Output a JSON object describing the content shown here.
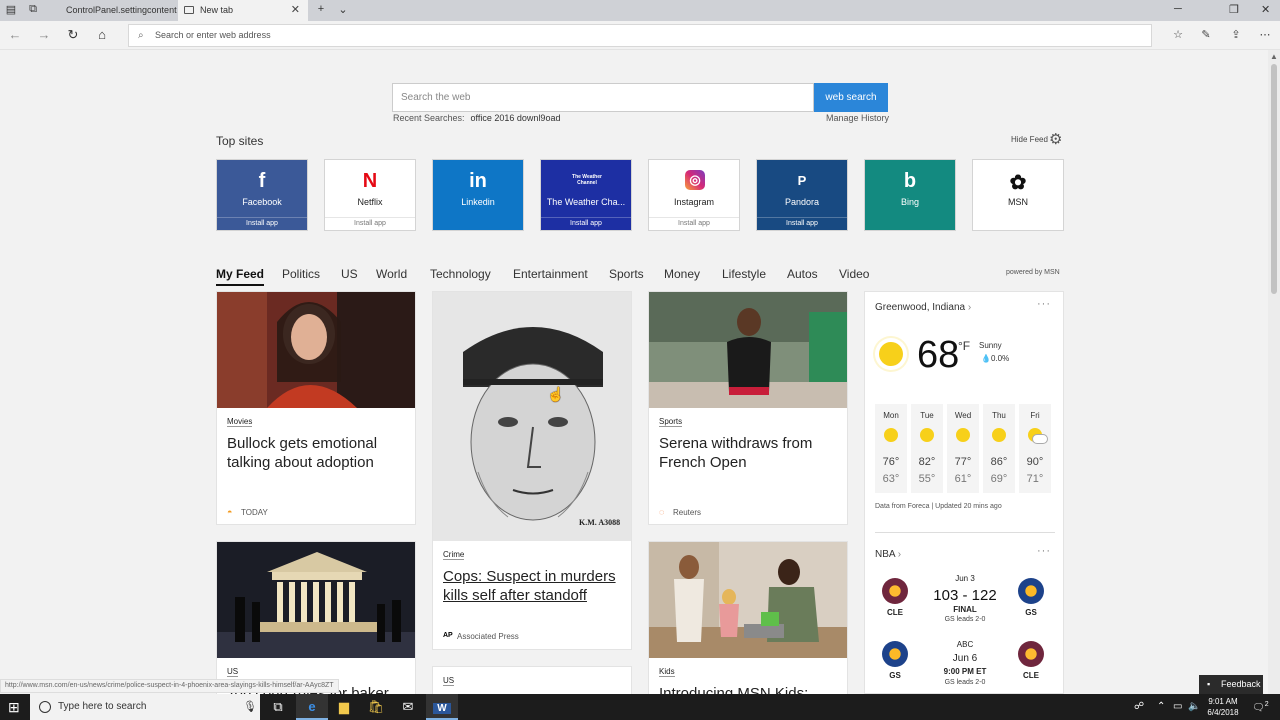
{
  "browser": {
    "tabs": [
      {
        "label": "ControlPanel.settingcontent"
      },
      {
        "label": "New tab"
      }
    ],
    "new_tab_icon": "plus-icon",
    "address_placeholder": "Search or enter web address"
  },
  "search": {
    "placeholder": "Search the web",
    "button_label": "web search",
    "recent_label": "Recent Searches:",
    "recent_value": "office 2016 downl9oad",
    "manage_history": "Manage History"
  },
  "top_sites": {
    "title": "Top sites",
    "hide_feed": "Hide Feed",
    "tiles": [
      {
        "name": "Facebook",
        "glyph": "f",
        "install": "Install app",
        "color": "#3b5998"
      },
      {
        "name": "Netflix",
        "glyph": "N",
        "install": "Install app",
        "color": "#ffffff"
      },
      {
        "name": "Linkedin",
        "glyph": "in",
        "install": "",
        "color": "#0e76c6"
      },
      {
        "name": "The Weather Cha...",
        "glyph": "The Weather Channel",
        "install": "Install app",
        "color": "#1d2fa3"
      },
      {
        "name": "Instagram",
        "glyph": "◎",
        "install": "Install app",
        "color": "#ffffff"
      },
      {
        "name": "Pandora",
        "glyph": "P",
        "install": "Install app",
        "color": "#184a82"
      },
      {
        "name": "Bing",
        "glyph": "b",
        "install": "",
        "color": "#138a80"
      },
      {
        "name": "MSN",
        "glyph": "✿",
        "install": "",
        "color": "#ffffff"
      }
    ]
  },
  "feed": {
    "tabs": [
      "My Feed",
      "Politics",
      "US",
      "World",
      "Technology",
      "Entertainment",
      "Sports",
      "Money",
      "Lifestyle",
      "Autos",
      "Video"
    ],
    "powered_by": "powered by MSN",
    "cards": [
      {
        "category": "Movies",
        "headline": "Bullock gets emotional talking about adoption",
        "source": "TODAY"
      },
      {
        "category": "Crime",
        "headline": "Cops: Suspect in murders kills self after standoff",
        "source": "Associated Press",
        "sketch_tag": "K.M. A3088"
      },
      {
        "category": "Sports",
        "headline": "Serena withdraws from French Open",
        "source": "Reuters"
      },
      {
        "category": "US",
        "headline": "Top court rules for baker"
      },
      {
        "category": "US",
        "headline": ""
      },
      {
        "category": "Kids",
        "headline": "Introducing MSN Kids:"
      }
    ]
  },
  "weather": {
    "location": "Greenwood, Indiana",
    "temp": "68",
    "unit": "°F",
    "condition": "Sunny",
    "precip": "0.0%",
    "forecast": [
      {
        "day": "Mon",
        "hi": "76°",
        "lo": "63°",
        "icon": "sun-icon"
      },
      {
        "day": "Tue",
        "hi": "82°",
        "lo": "55°",
        "icon": "sun-icon"
      },
      {
        "day": "Wed",
        "hi": "77°",
        "lo": "61°",
        "icon": "sun-icon"
      },
      {
        "day": "Thu",
        "hi": "86°",
        "lo": "69°",
        "icon": "sun-icon"
      },
      {
        "day": "Fri",
        "hi": "90°",
        "lo": "71°",
        "icon": "partly-cloudy-icon"
      }
    ],
    "footer": "Data from Foreca | Updated 20 mins ago"
  },
  "nba": {
    "title": "NBA",
    "games": [
      {
        "home": "CLE",
        "away": "GS",
        "date": "Jun 3",
        "score": "103 - 122",
        "status": "FINAL",
        "note": "GS leads 2-0"
      },
      {
        "home": "GS",
        "away": "CLE",
        "date": "ABC",
        "score": "Jun 6",
        "status": "9:00 PM ET",
        "note": "GS leads 2-0"
      }
    ]
  },
  "status_url": "http://www.msn.com/en-us/news/crime/police-suspect-in-4-phoenix-area-slayings-kills-himself/ar-AAyc8ZT",
  "feedback_label": "Feedback",
  "taskbar": {
    "search_placeholder": "Type here to search",
    "time": "9:01 AM",
    "date": "6/4/2018",
    "notification_count": "2"
  }
}
